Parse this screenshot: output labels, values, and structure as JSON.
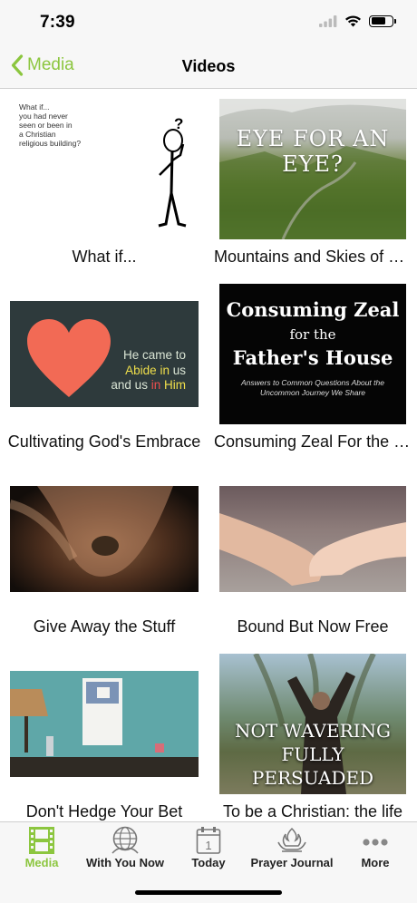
{
  "status_bar": {
    "time": "7:39"
  },
  "nav": {
    "back_label": "Media",
    "title": "Videos"
  },
  "videos": [
    {
      "caption": "What if...",
      "thumb_text": "What if...\nyou had never\nseen or been in\na Christian\nreligious building?"
    },
    {
      "caption": "Mountains and Skies of Colorado",
      "thumb_text": "EYE FOR AN EYE?"
    },
    {
      "caption": "Cultivating God's Embrace",
      "thumb_lines": [
        "He came to",
        "Abide",
        "in",
        "us",
        "and us",
        "in",
        "Him"
      ]
    },
    {
      "caption": "Consuming Zeal For the Father's House",
      "thumb_title_1": "Consuming Zeal",
      "thumb_title_2": "for the",
      "thumb_title_3": "Father's House",
      "thumb_sub": "Answers to Common Questions About the Uncommon Journey We Share"
    },
    {
      "caption": "Give Away the Stuff"
    },
    {
      "caption": "Bound But Now Free"
    },
    {
      "caption": "Don't Hedge Your Bet"
    },
    {
      "caption": "To be a Christian: the life",
      "thumb_line_1": "NOT WAVERING",
      "thumb_line_2": "FULLY PERSUADED"
    }
  ],
  "tabs": [
    {
      "label": "Media",
      "icon": "film-icon",
      "active": true
    },
    {
      "label": "With You Now",
      "icon": "globe-hands-icon",
      "active": false
    },
    {
      "label": "Today",
      "icon": "calendar-icon",
      "active": false,
      "calendar_day": "1"
    },
    {
      "label": "Prayer Journal",
      "icon": "flame-hands-icon",
      "active": false
    },
    {
      "label": "More",
      "icon": "more-dots-icon",
      "active": false
    }
  ],
  "colors": {
    "accent": "#8cc63f",
    "heart": "#f26a55"
  }
}
